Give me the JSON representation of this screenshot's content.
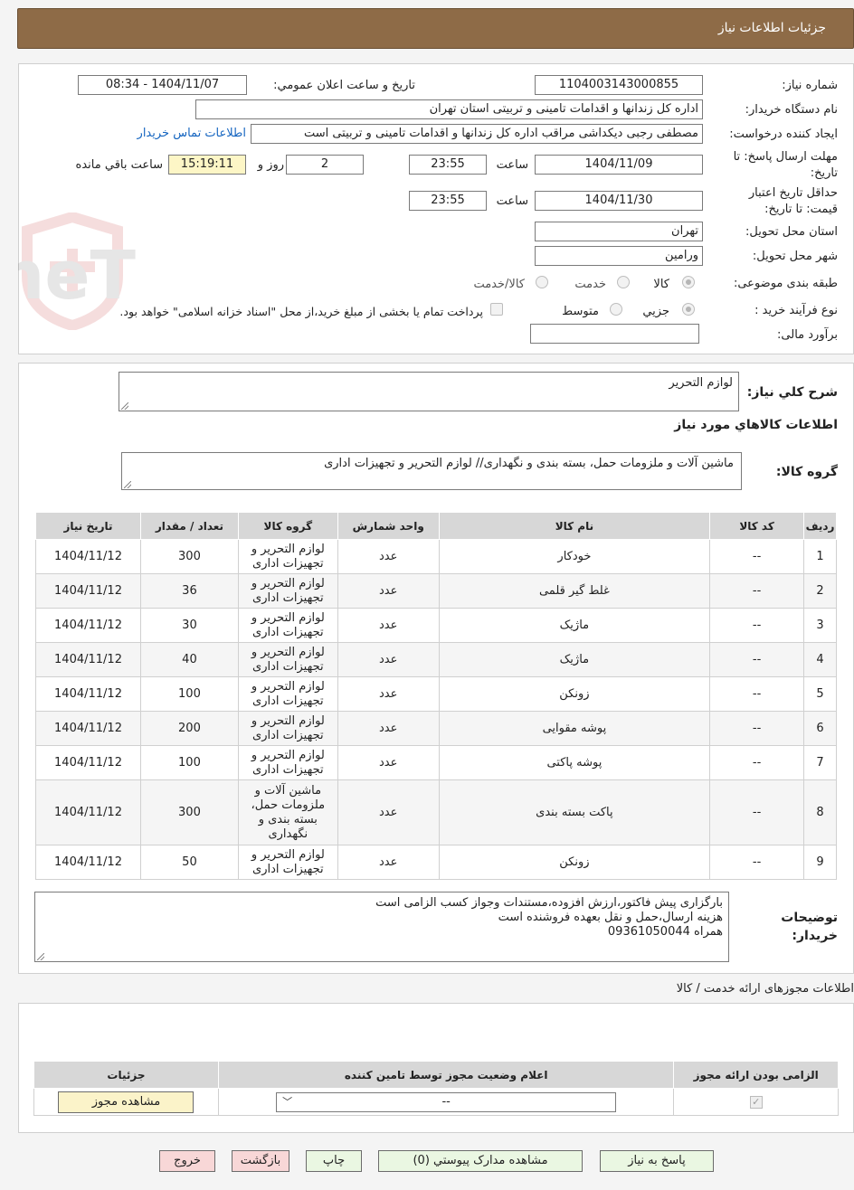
{
  "header": {
    "title": "جزئیات اطلاعات نیاز"
  },
  "info": {
    "need_number_label": "شماره نیاز:",
    "need_number": "1104003143000855",
    "announce_label": "تاریخ و ساعت اعلان عمومي:",
    "announce_value": "1404/11/07 - 08:34",
    "buyer_org_label": "نام دستگاه خریدار:",
    "buyer_org": "اداره کل زندانها و اقدامات تامینی و تربیتی استان تهران",
    "creator_label": "ایجاد کننده درخواست:",
    "creator": "مصطفی رجبی دیکداشی مراقب  اداره کل زندانها و اقدامات تامینی و تربیتی است",
    "contact_link": "اطلاعات تماس خریدار",
    "deadline_label_1": "مهلت ارسال پاسخ: تا",
    "deadline_label_2": "تاریخ:",
    "deadline_date": "1404/11/09",
    "time_label": "ساعت",
    "deadline_time": "23:55",
    "days_value": "2",
    "days_label": "روز و",
    "remaining_time": "15:19:11",
    "remaining_label": "ساعت باقي مانده",
    "validity_label_1": "حداقل تاریخ اعتبار",
    "validity_label_2": "قیمت: تا تاریخ:",
    "validity_date": "1404/11/30",
    "validity_time": "23:55",
    "province_label": "استان محل تحویل:",
    "province": "تهران",
    "city_label": "شهر محل تحویل:",
    "city": "ورامین",
    "category_label": "طبقه بندی موضوعی:",
    "category_options": [
      "کالا",
      "خدمت",
      "کالا/خدمت"
    ],
    "process_label": "نوع فرآیند خرید :",
    "process_options": [
      "جزیي",
      "متوسط"
    ],
    "process_note": "پرداخت تمام یا بخشی از مبلغ خرید،از محل \"اسناد خزانه اسلامی\" خواهد بود.",
    "estimate_label": "برآورد مالی:",
    "estimate_value": ""
  },
  "summary": {
    "label": "شرح کلي نیاز:",
    "value": "لوازم التحریر",
    "goods_info_title": "اطلاعات کالاهاي مورد نیاز",
    "group_label": "گروه کالا:",
    "group_value": "ماشین آلات و ملزومات حمل، بسته بندی و نگهداری// لوازم التحریر و تجهیزات اداری"
  },
  "table": {
    "headers": [
      "ردیف",
      "کد کالا",
      "نام کالا",
      "واحد شمارش",
      "گروه کالا",
      "تعداد / مقدار",
      "تاریخ نیاز"
    ],
    "rows": [
      [
        "1",
        "--",
        "خودکار",
        "عدد",
        "لوازم التحریر و تجهیزات اداری",
        "300",
        "1404/11/12"
      ],
      [
        "2",
        "--",
        "غلط گیر قلمی",
        "عدد",
        "لوازم التحریر و تجهیزات اداری",
        "36",
        "1404/11/12"
      ],
      [
        "3",
        "--",
        "ماژیک",
        "عدد",
        "لوازم التحریر و تجهیزات اداری",
        "30",
        "1404/11/12"
      ],
      [
        "4",
        "--",
        "ماژیک",
        "عدد",
        "لوازم التحریر و تجهیزات اداری",
        "40",
        "1404/11/12"
      ],
      [
        "5",
        "--",
        "زونکن",
        "عدد",
        "لوازم التحریر و تجهیزات اداری",
        "100",
        "1404/11/12"
      ],
      [
        "6",
        "--",
        "پوشه مقوایی",
        "عدد",
        "لوازم التحریر و تجهیزات اداری",
        "200",
        "1404/11/12"
      ],
      [
        "7",
        "--",
        "پوشه پاکتی",
        "عدد",
        "لوازم التحریر و تجهیزات اداری",
        "100",
        "1404/11/12"
      ],
      [
        "8",
        "--",
        "پاکت بسته بندی",
        "عدد",
        "ماشین آلات و ملزومات حمل، بسته بندی و نگهداری",
        "300",
        "1404/11/12"
      ],
      [
        "9",
        "--",
        "زونکن",
        "عدد",
        "لوازم التحریر و تجهیزات اداری",
        "50",
        "1404/11/12"
      ]
    ]
  },
  "buyer_notes": {
    "label_1": "توضیحات",
    "label_2": "خریدار:",
    "lines": [
      "بارگزاری پیش فاکتور،ارزش افزوده،مستندات وجواز کسب الزامی است",
      "هزینه ارسال،حمل و نقل بعهده فروشنده است",
      "همراه 09361050044"
    ]
  },
  "permits": {
    "title": "اطلاعات مجوزهای ارائه خدمت / کالا",
    "headers": [
      "الزامی بودن ارائه مجوز",
      "اعلام وضعیت مجوز توسط تامین کننده",
      "جزئیات"
    ],
    "select_value": "--",
    "view_button": "مشاهده مجوز"
  },
  "watermark": "AriaTender.neT",
  "buttons": {
    "reply": "پاسخ به نیاز",
    "attachments": "مشاهده مدارک پیوستي (0)",
    "print": "چاپ",
    "back": "بازگشت",
    "exit": "خروج"
  }
}
